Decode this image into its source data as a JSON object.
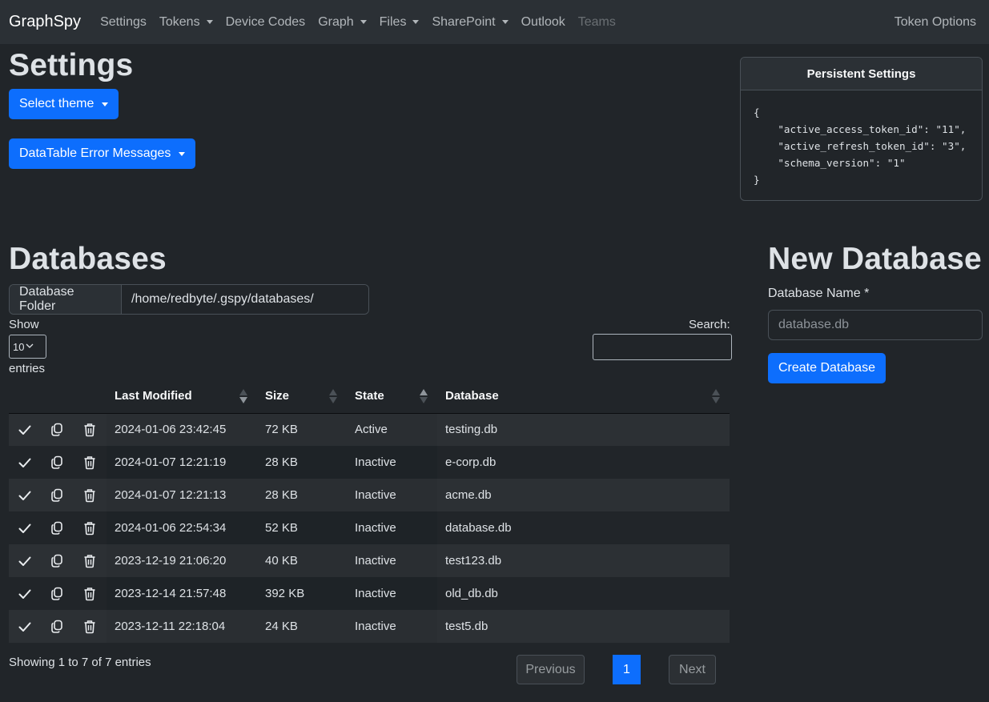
{
  "navbar": {
    "brand": "GraphSpy",
    "items": [
      {
        "label": "Settings",
        "dropdown": false,
        "disabled": false
      },
      {
        "label": "Tokens",
        "dropdown": true,
        "disabled": false
      },
      {
        "label": "Device Codes",
        "dropdown": false,
        "disabled": false
      },
      {
        "label": "Graph",
        "dropdown": true,
        "disabled": false
      },
      {
        "label": "Files",
        "dropdown": true,
        "disabled": false
      },
      {
        "label": "SharePoint",
        "dropdown": true,
        "disabled": false
      },
      {
        "label": "Outlook",
        "dropdown": false,
        "disabled": false
      },
      {
        "label": "Teams",
        "dropdown": false,
        "disabled": true
      }
    ],
    "right_item": "Token Options"
  },
  "settings": {
    "title": "Settings",
    "theme_button": "Select theme",
    "datatable_errors_button": "DataTable Error Messages"
  },
  "persistent_settings": {
    "title": "Persistent Settings",
    "json_text": "{\n    \"active_access_token_id\": \"11\",\n    \"active_refresh_token_id\": \"3\",\n    \"schema_version\": \"1\"\n}"
  },
  "databases": {
    "title": "Databases",
    "folder_label": "Database Folder",
    "folder_value": "/home/redbyte/.gspy/databases/",
    "show_label": "Show",
    "page_length": "10",
    "entries_label": "entries",
    "search_label": "Search:",
    "search_value": "",
    "columns": [
      "",
      "",
      "",
      "Last Modified",
      "Size",
      "State",
      "Database"
    ],
    "rows": [
      {
        "last_modified": "2024-01-06 23:42:45",
        "size": "72 KB",
        "state": "Active",
        "database": "testing.db"
      },
      {
        "last_modified": "2024-01-07 12:21:19",
        "size": "28 KB",
        "state": "Inactive",
        "database": "e-corp.db"
      },
      {
        "last_modified": "2024-01-07 12:21:13",
        "size": "28 KB",
        "state": "Inactive",
        "database": "acme.db"
      },
      {
        "last_modified": "2024-01-06 22:54:34",
        "size": "52 KB",
        "state": "Inactive",
        "database": "database.db"
      },
      {
        "last_modified": "2023-12-19 21:06:20",
        "size": "40 KB",
        "state": "Inactive",
        "database": "test123.db"
      },
      {
        "last_modified": "2023-12-14 21:57:48",
        "size": "392 KB",
        "state": "Inactive",
        "database": "old_db.db"
      },
      {
        "last_modified": "2023-12-11 22:18:04",
        "size": "24 KB",
        "state": "Inactive",
        "database": "test5.db"
      }
    ],
    "row_icons": [
      "check-icon",
      "copy-icon",
      "trash-icon"
    ],
    "info": "Showing 1 to 7 of 7 entries",
    "pagination": {
      "previous": "Previous",
      "current": "1",
      "next": "Next"
    }
  },
  "new_database": {
    "title": "New Database",
    "name_label": "Database Name *",
    "name_placeholder": "database.db",
    "name_value": "",
    "create_button": "Create Database"
  },
  "colors": {
    "accent": "#0d6efd",
    "background": "#212529",
    "navbar": "#2b3035"
  }
}
